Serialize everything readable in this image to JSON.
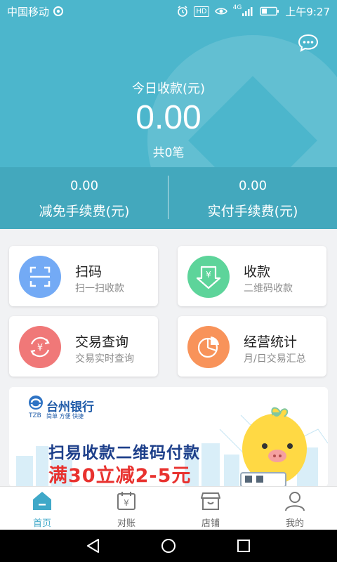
{
  "status_bar": {
    "carrier": "中国移动",
    "network": "4G",
    "hd": "HD",
    "time": "上午9:27"
  },
  "summary": {
    "title": "今日收款(元)",
    "amount": "0.00",
    "count": "共0笔"
  },
  "fees": {
    "waived_value": "0.00",
    "waived_label": "减免手续费(元)",
    "paid_value": "0.00",
    "paid_label": "实付手续费(元)"
  },
  "actions": [
    {
      "title": "扫码",
      "subtitle": "扫一扫收款",
      "icon": "scan-icon",
      "color": "#73aaf5"
    },
    {
      "title": "收款",
      "subtitle": "二维码收款",
      "icon": "receive-money-icon",
      "color": "#5dd49a"
    },
    {
      "title": "交易查询",
      "subtitle": "交易实时查询",
      "icon": "transaction-query-icon",
      "color": "#f07878"
    },
    {
      "title": "经营统计",
      "subtitle": "月/日交易汇总",
      "icon": "stats-pie-icon",
      "color": "#f8935a"
    }
  ],
  "banner": {
    "bank_name": "台州银行",
    "bank_abbr": "TZB",
    "bank_tagline": "简单 方便 快捷",
    "headline": "扫易收款二维码付款",
    "promo": "满30立减2-5元"
  },
  "tabs": [
    {
      "label": "首页",
      "icon": "home-icon"
    },
    {
      "label": "对账",
      "icon": "reconcile-calendar-icon"
    },
    {
      "label": "店铺",
      "icon": "store-icon"
    },
    {
      "label": "我的",
      "icon": "user-icon"
    }
  ],
  "colors": {
    "hero": "#4cb6cc",
    "fees_band": "#43a8bd",
    "tab_active": "#3fa8c8",
    "promo_red": "#e8322f",
    "headline_blue": "#1d3f8a"
  }
}
